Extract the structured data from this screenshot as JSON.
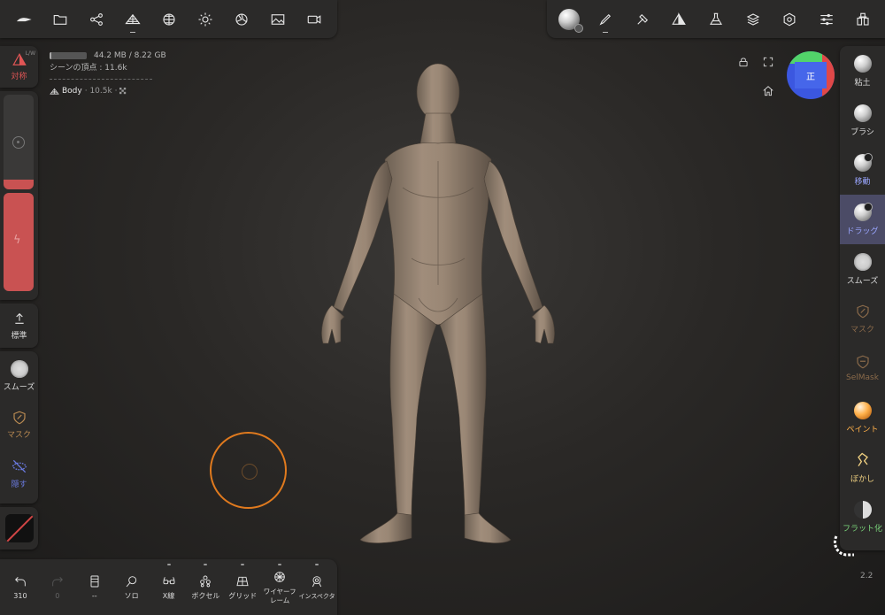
{
  "top_left_toolbar": {
    "icons": [
      "logo-icon",
      "folder-icon",
      "share-icon",
      "mesh-icon",
      "sphere-grid-icon",
      "light-icon",
      "shading-icon",
      "image-icon",
      "camera-icon"
    ]
  },
  "top_right_toolbar": {
    "icons": [
      "matcap-icon",
      "brush-icon",
      "hammer-icon",
      "triangle-icon",
      "flask-icon",
      "layers-icon",
      "settings-icon",
      "sliders-icon",
      "scene-icon"
    ]
  },
  "stats": {
    "memory": "44.2 MB / 8.22 GB",
    "memory_used_fraction": 0.05,
    "scene_vertices": "シーンの頂点 : 11.6k",
    "mesh_name": "Body",
    "mesh_vertices": "· 10.5k ·"
  },
  "left_panel": {
    "symmetry_label": "対称",
    "lw_label": "L/W",
    "radius_fill_fraction": 0.1,
    "intensity_fill_fraction": 1.0,
    "standard_label": "標準",
    "tools": [
      {
        "label": "スムーズ",
        "color": "#dcdcdc"
      },
      {
        "label": "マスク",
        "color": "#b98a52"
      },
      {
        "label": "隠す",
        "color": "#6a7ae0"
      }
    ]
  },
  "right_tools": [
    {
      "label": "粘土",
      "color": "#dcdcdc"
    },
    {
      "label": "ブラシ",
      "color": "#dcdcdc"
    },
    {
      "label": "移動",
      "color": "#9aa6ff"
    },
    {
      "label": "ドラッグ",
      "color": "#9aa6ff",
      "active": true
    },
    {
      "label": "スムーズ",
      "color": "#dcdcdc"
    },
    {
      "label": "マスク",
      "color": "#8a6a4a"
    },
    {
      "label": "SelMask",
      "color": "#8a6a4a"
    },
    {
      "label": "ペイント",
      "color": "#ffb04a"
    },
    {
      "label": "ぼかし",
      "color": "#f0d080"
    },
    {
      "label": "フラット化",
      "color": "#7ad47a"
    }
  ],
  "gizmo": {
    "face_label": "正"
  },
  "bottom_bar": [
    {
      "label": "310",
      "icon": "undo-icon"
    },
    {
      "label": "0",
      "icon": "redo-icon",
      "dim": true
    },
    {
      "label": "--",
      "icon": "stack-icon"
    },
    {
      "label": "ソロ",
      "icon": "search-icon"
    },
    {
      "label": "X線",
      "icon": "glasses-icon"
    },
    {
      "label": "ボクセル",
      "icon": "voxel-icon"
    },
    {
      "label": "グリッド",
      "icon": "grid-icon"
    },
    {
      "label": "ワイヤーフレーム",
      "icon": "wireframe-icon"
    },
    {
      "label": "インスペクタ",
      "icon": "inspector-icon"
    }
  ],
  "version": "2.2",
  "colors": {
    "accent_red": "#c95252",
    "active_tool_bg": "#4b4b66",
    "brush_cursor": "#e07a1e",
    "panel_bg": "#2b2a29"
  }
}
